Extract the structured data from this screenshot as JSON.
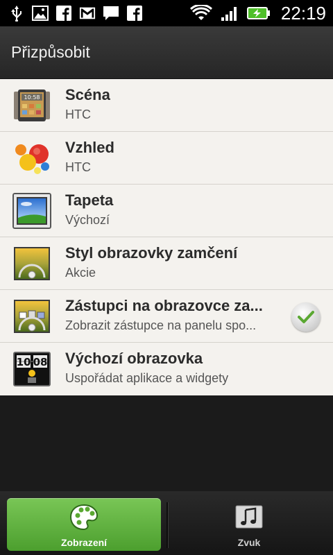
{
  "status_bar": {
    "left_icons": [
      "usb-icon",
      "image-icon",
      "facebook-icon",
      "gmail-icon",
      "message-icon",
      "facebook-icon"
    ],
    "right_icons": [
      "wifi-icon",
      "signal-icon",
      "battery-charging-icon"
    ],
    "time": "22:19"
  },
  "header": {
    "title": "Přizpůsobit"
  },
  "list": {
    "items": [
      {
        "title": "Scéna",
        "subtitle": "HTC",
        "icon": "scene-icon"
      },
      {
        "title": "Vzhled",
        "subtitle": "HTC",
        "icon": "skin-icon"
      },
      {
        "title": "Tapeta",
        "subtitle": "Výchozí",
        "icon": "wallpaper-icon"
      },
      {
        "title": "Styl obrazovky zamčení",
        "subtitle": "Akcie",
        "icon": "lockscreen-style-icon"
      },
      {
        "title": "Zástupci na obrazovce za...",
        "subtitle": "Zobrazit zástupce na panelu spo...",
        "icon": "lockscreen-shortcuts-icon",
        "checked": true
      },
      {
        "title": "Výchozí obrazovka",
        "subtitle": "Uspořádat aplikace a widgety",
        "icon": "home-screen-icon",
        "clock_text": "10 08"
      }
    ]
  },
  "tabs": [
    {
      "label": "Zobrazení",
      "icon": "palette-icon",
      "active": true
    },
    {
      "label": "Zvuk",
      "icon": "music-note-icon",
      "active": false
    }
  ],
  "colors": {
    "accent": "#5fb33d",
    "list_bg": "#f4f2ee",
    "check_green": "#5aa832"
  }
}
